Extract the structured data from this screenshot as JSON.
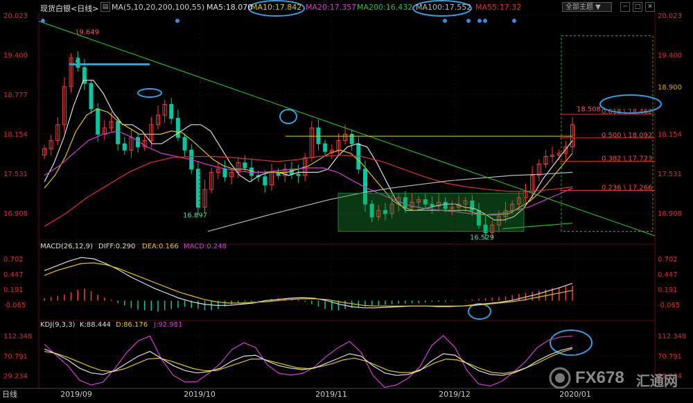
{
  "header": {
    "title": "现货白银<日线>",
    "ma_label": "MA(5,10,20,200,100,55)",
    "ma5": "MA5:18.070",
    "ma10": "MA10:17.842",
    "ma20": "MA20:17.357",
    "ma200": "MA200:16.432",
    "ma100": "MA100:17.552",
    "ma55": "MA55:17.32",
    "theme_button": "全部主题",
    "colors": {
      "ma5": "#e0e0e0",
      "ma10": "#e0c800",
      "ma20": "#d040d0",
      "ma200": "#30c030",
      "ma100": "#bbbbbb",
      "ma55": "#e03030"
    }
  },
  "watermark": {
    "brand": "FX678",
    "cn": "汇通网"
  },
  "chart_data": [
    {
      "type": "candlestick",
      "name": "price",
      "ylim": [
        16.55,
        20.023
      ],
      "y_ticks_left": [
        "20.023",
        "19.400",
        "18.777",
        "18.154",
        "17.531",
        "16.908"
      ],
      "y_ticks_right": [
        "20.023",
        "19.400",
        "18.900",
        "18.154",
        "17.531",
        "16.908"
      ],
      "x_labels": [
        "2019/09",
        "2019/10",
        "2019/11",
        "2019/12",
        "2020/01"
      ],
      "annotations": [
        {
          "text": "19.649",
          "color": "#ff5050"
        },
        {
          "text": "16.897",
          "color": "#50e0a0"
        },
        {
          "text": "16.529",
          "color": "#50e0a0"
        },
        {
          "text": "18.508",
          "color": "#ff5050"
        }
      ],
      "fib_levels": [
        {
          "label": "0.618 \\ 18.462",
          "value": 18.462
        },
        {
          "label": "0.500 \\ 18.092",
          "value": 18.092
        },
        {
          "label": "0.382 \\ 17.723",
          "value": 17.723
        },
        {
          "label": "0.236 \\ 17.266",
          "value": 17.266
        }
      ],
      "closes": [
        17.92,
        18.05,
        18.3,
        18.9,
        19.35,
        19.2,
        18.95,
        18.55,
        18.15,
        18.25,
        18.35,
        18.0,
        17.9,
        18.1,
        17.95,
        18.05,
        18.3,
        18.45,
        18.62,
        18.4,
        18.1,
        17.9,
        17.6,
        17.0,
        17.28,
        17.55,
        17.6,
        17.48,
        17.55,
        17.7,
        17.62,
        17.5,
        17.48,
        17.35,
        17.55,
        17.5,
        17.6,
        17.52,
        17.5,
        17.78,
        18.25,
        18.0,
        17.88,
        17.9,
        18.05,
        18.15,
        18.0,
        17.6,
        17.05,
        16.85,
        16.95,
        16.9,
        17.05,
        17.15,
        17.0,
        17.08,
        17.12,
        17.05,
        17.02,
        17.08,
        16.98,
        17.0,
        17.05,
        17.1,
        16.95,
        16.72,
        16.6,
        16.72,
        16.85,
        16.95,
        17.05,
        17.15,
        17.25,
        17.5,
        17.68,
        17.8,
        17.82,
        17.85,
        17.95,
        18.3
      ],
      "ma_series": [
        {
          "name": "MA5",
          "color": "#e0e0e0",
          "values": [
            17.4,
            17.7,
            18.1,
            18.6,
            19.0,
            19.0,
            18.8,
            18.5,
            18.3,
            18.3,
            18.2,
            18.0,
            18.0,
            18.1,
            18.2,
            18.3,
            18.3,
            18.2,
            17.95,
            17.7,
            17.5,
            17.4,
            17.5,
            17.55,
            17.55,
            17.5,
            17.55,
            17.55,
            17.55,
            17.6,
            17.8,
            17.95,
            18.0,
            17.95,
            17.7,
            17.4,
            17.1,
            16.95,
            16.95,
            16.98,
            17.02,
            17.05,
            17.05,
            17.0,
            16.98,
            16.9,
            16.8,
            16.8,
            16.85,
            16.98,
            17.2,
            17.45,
            17.65,
            17.85,
            18.05
          ]
        },
        {
          "name": "MA10",
          "color": "#e0c800",
          "values": [
            17.3,
            17.5,
            17.8,
            18.2,
            18.45,
            18.55,
            18.5,
            18.35,
            18.25,
            18.15,
            18.15,
            18.15,
            18.2,
            18.18,
            18.05,
            17.9,
            17.75,
            17.65,
            17.6,
            17.6,
            17.55,
            17.55,
            17.55,
            17.55,
            17.6,
            17.65,
            17.75,
            17.85,
            17.9,
            17.85,
            17.7,
            17.5,
            17.3,
            17.1,
            17.0,
            16.95,
            16.95,
            16.95,
            16.95,
            16.95,
            16.95,
            16.9,
            16.88,
            16.88,
            16.9,
            17.0,
            17.1,
            17.25,
            17.45,
            17.65,
            17.85
          ]
        },
        {
          "name": "MA20",
          "color": "#d040d0",
          "values": [
            17.5,
            17.65,
            17.85,
            18.05,
            18.15,
            18.2,
            18.1,
            17.95,
            17.85,
            17.8,
            17.75,
            17.68,
            17.62,
            17.58,
            17.55,
            17.55,
            17.58,
            17.6,
            17.62,
            17.62,
            17.55,
            17.42,
            17.3,
            17.2,
            17.1,
            17.02,
            16.98,
            16.95,
            16.93,
            16.9,
            16.88,
            16.9,
            16.95,
            17.0,
            17.1,
            17.2,
            17.3
          ]
        },
        {
          "name": "MA55",
          "color": "#e03030",
          "values": [
            16.7,
            16.9,
            17.15,
            17.35,
            17.55,
            17.7,
            17.78,
            17.8,
            17.8,
            17.78,
            17.75,
            17.72,
            17.75,
            17.8,
            17.82,
            17.8,
            17.72,
            17.6,
            17.48,
            17.38,
            17.32,
            17.28,
            17.25,
            17.25,
            17.28,
            17.32
          ]
        },
        {
          "name": "MA100",
          "color": "#bbbbbb",
          "values": [
            16.62,
            16.75,
            16.88,
            17.0,
            17.12,
            17.22,
            17.3,
            17.36,
            17.42,
            17.46,
            17.5,
            17.52,
            17.55
          ]
        },
        {
          "name": "MA200",
          "color": "#30c030",
          "values": [
            16.66,
            16.75
          ]
        }
      ]
    },
    {
      "type": "bar",
      "name": "MACD(26,12,9)",
      "labels": {
        "title": "MACD(26,12,9)",
        "diff": "DIFF:0.290",
        "dea": "DEA:0.166",
        "macd": "MACD:0.248"
      },
      "ylim": [
        -0.25,
        0.85
      ],
      "y_ticks": [
        "0.702",
        "0.447",
        "0.191",
        "-0.065"
      ],
      "histogram": [
        0.04,
        0.06,
        0.08,
        0.1,
        0.14,
        0.18,
        0.2,
        0.16,
        0.1,
        0.05,
        0.02,
        -0.04,
        -0.08,
        -0.12,
        -0.15,
        -0.16,
        -0.17,
        -0.18,
        -0.16,
        -0.14,
        -0.12,
        -0.1,
        -0.12,
        -0.14,
        -0.16,
        -0.16,
        -0.14,
        -0.1,
        -0.06,
        -0.03,
        -0.02,
        -0.02,
        -0.01,
        0.01,
        0.03,
        0.04,
        0.04,
        0.03,
        0.02,
        -0.02,
        -0.06,
        -0.1,
        -0.14,
        -0.16,
        -0.16,
        -0.14,
        -0.12,
        -0.11,
        -0.1,
        -0.09,
        -0.08,
        -0.07,
        -0.06,
        -0.05,
        -0.05,
        -0.04,
        -0.04,
        -0.03,
        -0.02,
        -0.02,
        -0.02,
        -0.01,
        0.0,
        0.01,
        0.02,
        0.03,
        0.04,
        0.05,
        0.06,
        0.07,
        0.09,
        0.11,
        0.13,
        0.15,
        0.17,
        0.19,
        0.21,
        0.22,
        0.24,
        0.25
      ],
      "diff": [
        0.5,
        0.58,
        0.66,
        0.72,
        0.7,
        0.62,
        0.52,
        0.4,
        0.3,
        0.2,
        0.12,
        0.04,
        -0.02,
        -0.06,
        -0.08,
        -0.08,
        -0.06,
        -0.04,
        0.0,
        0.02,
        0.04,
        0.05,
        0.04,
        0.0,
        -0.06,
        -0.1,
        -0.12,
        -0.12,
        -0.11,
        -0.1,
        -0.09,
        -0.09,
        -0.1,
        -0.1,
        -0.09,
        -0.07,
        -0.05,
        -0.03,
        0.0,
        0.05,
        0.1,
        0.16,
        0.22,
        0.29
      ],
      "dea": [
        0.42,
        0.5,
        0.56,
        0.62,
        0.63,
        0.6,
        0.54,
        0.46,
        0.38,
        0.3,
        0.22,
        0.14,
        0.08,
        0.02,
        -0.02,
        -0.04,
        -0.04,
        -0.03,
        -0.02,
        0.0,
        0.02,
        0.03,
        0.03,
        0.02,
        -0.02,
        -0.05,
        -0.08,
        -0.09,
        -0.09,
        -0.09,
        -0.09,
        -0.09,
        -0.09,
        -0.09,
        -0.09,
        -0.08,
        -0.06,
        -0.04,
        -0.02,
        0.01,
        0.05,
        0.09,
        0.13,
        0.17
      ]
    },
    {
      "type": "line",
      "name": "KDJ(9,3,3)",
      "labels": {
        "title": "KDJ(9,3,3)",
        "k": "K:88.444",
        "d": "D:86.176",
        "j": "J:92.981"
      },
      "ylim": [
        10,
        130
      ],
      "y_ticks": [
        "112.348",
        "70.791",
        "29.234"
      ],
      "k": [
        85,
        75,
        62,
        45,
        35,
        32,
        40,
        55,
        70,
        80,
        65,
        50,
        40,
        35,
        38,
        45,
        60,
        70,
        72,
        60,
        50,
        45,
        42,
        45,
        55,
        65,
        75,
        70,
        50,
        35,
        30,
        32,
        40,
        60,
        75,
        72,
        55,
        40,
        32,
        30,
        35,
        45,
        60,
        72,
        82,
        88
      ],
      "d": [
        80,
        76,
        68,
        58,
        48,
        40,
        38,
        44,
        54,
        64,
        66,
        60,
        52,
        44,
        40,
        40,
        48,
        56,
        64,
        64,
        58,
        52,
        46,
        44,
        48,
        54,
        62,
        66,
        60,
        50,
        40,
        36,
        36,
        44,
        56,
        64,
        62,
        54,
        44,
        36,
        34,
        38,
        46,
        56,
        68,
        78,
        86
      ],
      "j": [
        95,
        72,
        50,
        20,
        10,
        16,
        44,
        77,
        102,
        112,
        63,
        30,
        16,
        17,
        34,
        55,
        84,
        98,
        88,
        52,
        34,
        31,
        34,
        47,
        69,
        87,
        101,
        78,
        30,
        5,
        10,
        24,
        48,
        92,
        113,
        88,
        41,
        12,
        8,
        18,
        37,
        59,
        88,
        104,
        110,
        112
      ]
    }
  ]
}
